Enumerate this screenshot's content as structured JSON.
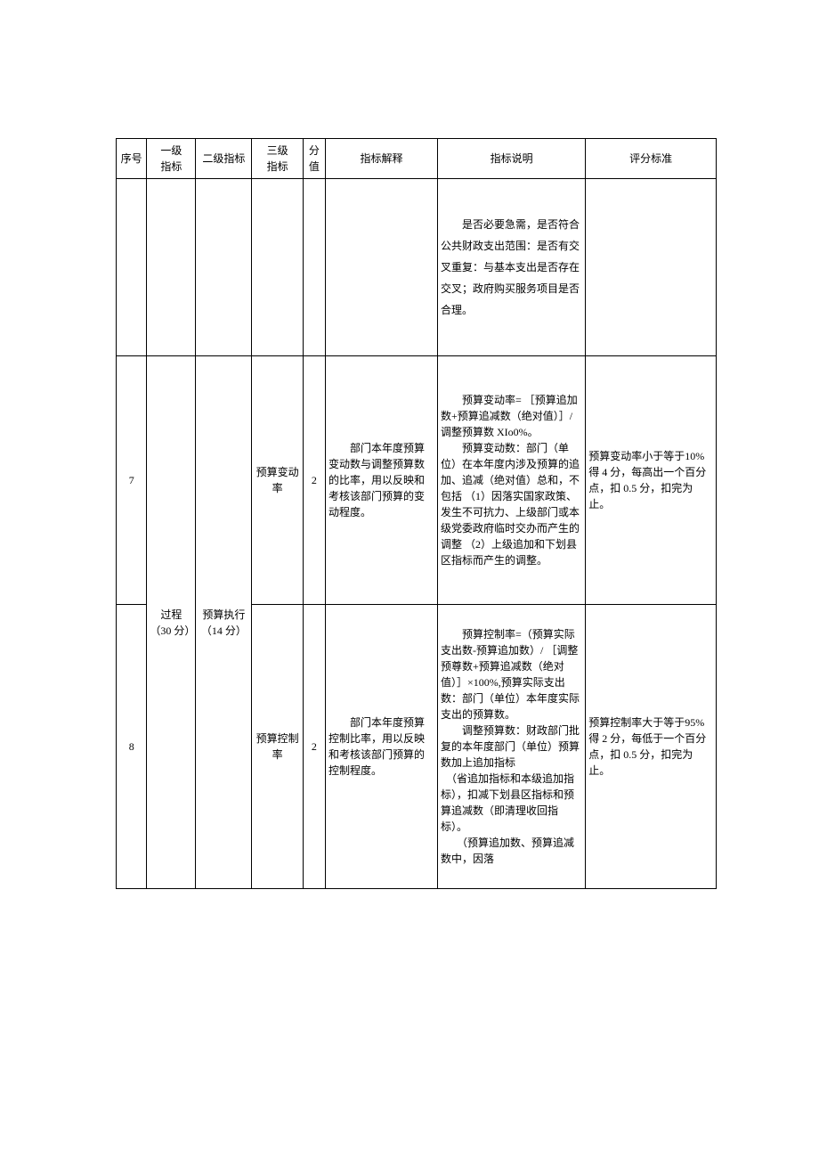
{
  "headers": {
    "no": "序号",
    "l1": "一级\n指标",
    "l2": "二级指标",
    "l3": "三级\n指标",
    "score": "分\n值",
    "interp": "指标解释",
    "desc": "指标说明",
    "crit": "评分标准"
  },
  "rows": [
    {
      "no": "",
      "l1": "",
      "l2": "",
      "l3": "",
      "score": "",
      "interp": "",
      "desc": "　　是否必要急需，是否符合公共财政支出范围：是否有交叉重复：与基本支出是否存在交叉；政府购买服务项目是否合理。",
      "crit": ""
    },
    {
      "no": "7",
      "l1": "过程\n（30 分）",
      "l2": "预算执行\n（14 分）",
      "l3": "预算变动率",
      "score": "2",
      "interp": "　　部门本年度预算变动数与调整预算数的比率，用以反映和考核该部门预算的变动程度。",
      "desc": "　　预算变动率= ［预算追加数+预算追减数（绝对值）］/调整预算数 XIo0%。\n　　预算变动数：部门（单位）在本年度内涉及预算的追加、追减（绝对值）总和，不包括  （1）因落实国家政策、发生不可抗力、上级部门或本级党委政府临时交办而产生的调整   （2）上级追加和下划县区指标而产生的调整。",
      "crit": "预算变动率小于等于10%得 4 分，每高出一个百分点，扣 0.5 分，扣完为止。"
    },
    {
      "no": "8",
      "l1": "",
      "l2": "",
      "l3": "预算控制率",
      "score": "2",
      "interp": "　　部门本年度预算控制比率，用以反映和考核该部门预算的控制程度。",
      "desc": "　　预算控制率=（预算实际支出数-预算追加数）/ ［调整预尊数+预算追减数（绝对值）］×100%,预算实际支出数：部门（单位）本年度实际支出的预算数。\n　　调整预算数：财政部门批复的本年度部门（单位）预算数加上追加指标\n　（省追加指标和本级追加指标），扣减下划县区指标和预算追减数（即清理收回指标）。\n　　（预算追加数、预算追减数中，因落",
      "crit": "预算控制率大于等于95%得 2 分，每低于一个百分点，扣 0.5 分，扣完为止。"
    }
  ]
}
